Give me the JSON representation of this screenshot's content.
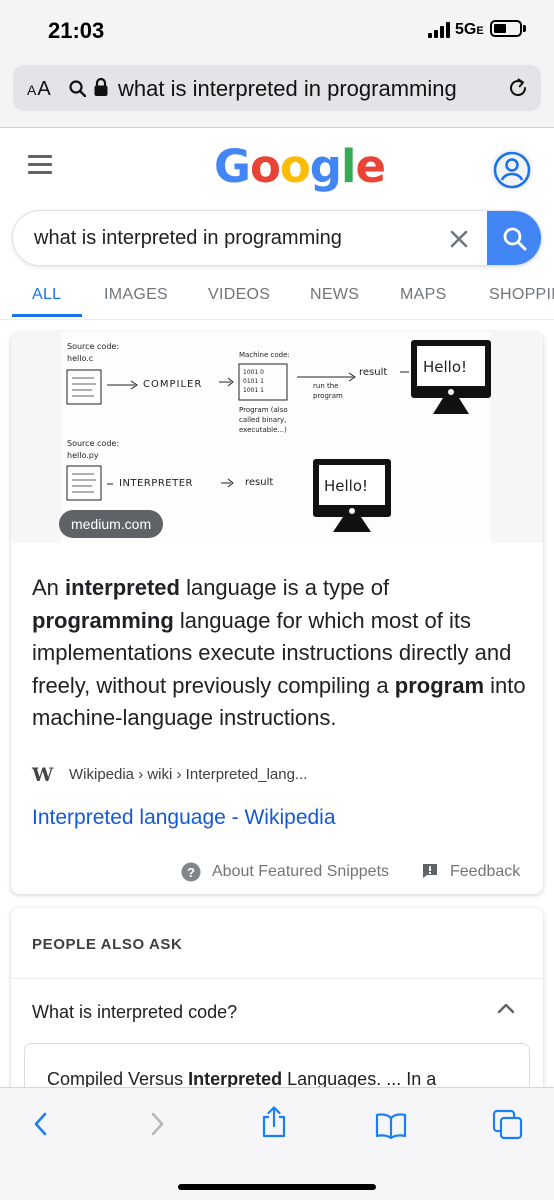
{
  "status_bar": {
    "time": "21:03",
    "network": "5G",
    "network_suffix": "E"
  },
  "browser": {
    "aa_label": "AA",
    "url_text": "what is interpreted in programming"
  },
  "google": {
    "logo_letters": [
      "G",
      "o",
      "o",
      "g",
      "l",
      "e"
    ],
    "search_query": "what is interpreted in programming"
  },
  "tabs": [
    {
      "label": "ALL",
      "active": true
    },
    {
      "label": "IMAGES"
    },
    {
      "label": "VIDEOS"
    },
    {
      "label": "NEWS"
    },
    {
      "label": "MAPS"
    },
    {
      "label": "SHOPPING"
    }
  ],
  "featured_snippet": {
    "image_source": "medium.com",
    "diagram": {
      "source_code_1": "Source code:",
      "file_1": "hello.c",
      "compiler": "COMPILER",
      "machine_code": "Machine code:",
      "program_note_1": "Program (also",
      "program_note_2": "called binary,",
      "program_note_3": "executable...)",
      "run_the": "run the",
      "program": "program",
      "result": "result",
      "hello": "Hello!",
      "source_code_2": "Source code:",
      "file_2": "hello.py",
      "interpreter": "INTERPRETER"
    },
    "text_parts": [
      {
        "t": "An ",
        "bold": false
      },
      {
        "t": "interpreted",
        "bold": true
      },
      {
        "t": " language is a type of ",
        "bold": false
      },
      {
        "t": "programming",
        "bold": true
      },
      {
        "t": " language for which most of its implementations execute instructions directly and freely, without previously compiling a ",
        "bold": false
      },
      {
        "t": "program",
        "bold": true
      },
      {
        "t": " into machine-language instructions.",
        "bold": false
      }
    ],
    "source_icon": "W",
    "breadcrumb": "Wikipedia › wiki › Interpreted_lang...",
    "link_title": "Interpreted language - Wikipedia",
    "about_label": "About Featured Snippets",
    "feedback_label": "Feedback"
  },
  "people_also_ask": {
    "title": "PEOPLE ALSO ASK",
    "question": "What is interpreted code?",
    "answer_parts": [
      {
        "t": "Compiled Versus ",
        "bold": false
      },
      {
        "t": "Interpreted",
        "bold": true
      },
      {
        "t": " Languages. ... In a",
        "bold": false
      }
    ]
  },
  "colors": {
    "accent_blue": "#4285f4",
    "link_blue": "#1558d6",
    "tab_active": "#1a73e8"
  }
}
